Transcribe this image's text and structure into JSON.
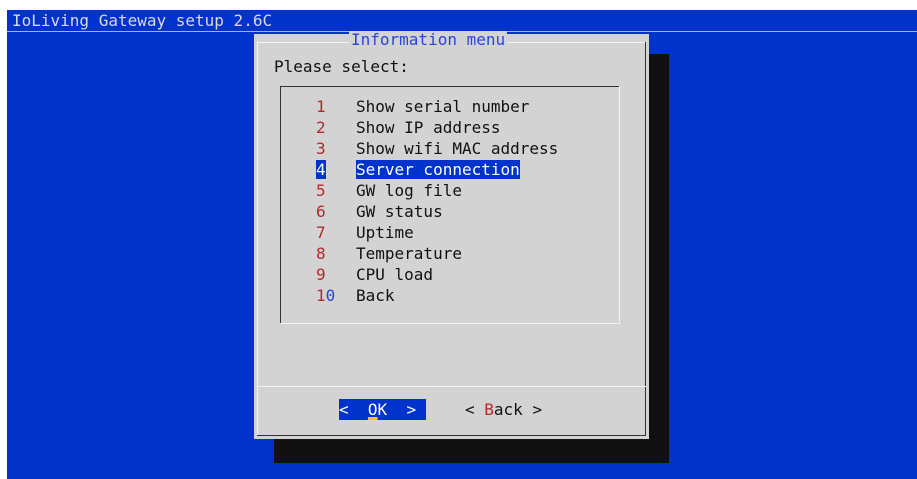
{
  "backtitle": "IoLiving Gateway setup 2.6C",
  "dialog": {
    "title": "Information menu",
    "prompt": "Please select:"
  },
  "menu": {
    "selected_tag": "4",
    "items": [
      {
        "tag": "1",
        "label": "Show serial number"
      },
      {
        "tag": "2",
        "label": "Show IP address"
      },
      {
        "tag": "3",
        "label": "Show wifi MAC address"
      },
      {
        "tag": "4",
        "label": "Server connection"
      },
      {
        "tag": "5",
        "label": "GW log file"
      },
      {
        "tag": "6",
        "label": "GW status"
      },
      {
        "tag": "7",
        "label": "Uptime"
      },
      {
        "tag": "8",
        "label": "Temperature"
      },
      {
        "tag": "9",
        "label": "CPU load"
      },
      {
        "tag": "10",
        "label": "Back"
      }
    ]
  },
  "buttons": {
    "ok": {
      "left": "<  ",
      "hotkey": "O",
      "rest": "K",
      "right": "  >"
    },
    "back": {
      "left": "< ",
      "hotkey": "B",
      "rest": "ack",
      "right": " >"
    }
  },
  "colors": {
    "screen": "#0033cc",
    "dialog": "#d3d3d3",
    "tag": "#b42a2a",
    "title": "#2a44dd",
    "hotkey_underline": "#ffcc00"
  }
}
